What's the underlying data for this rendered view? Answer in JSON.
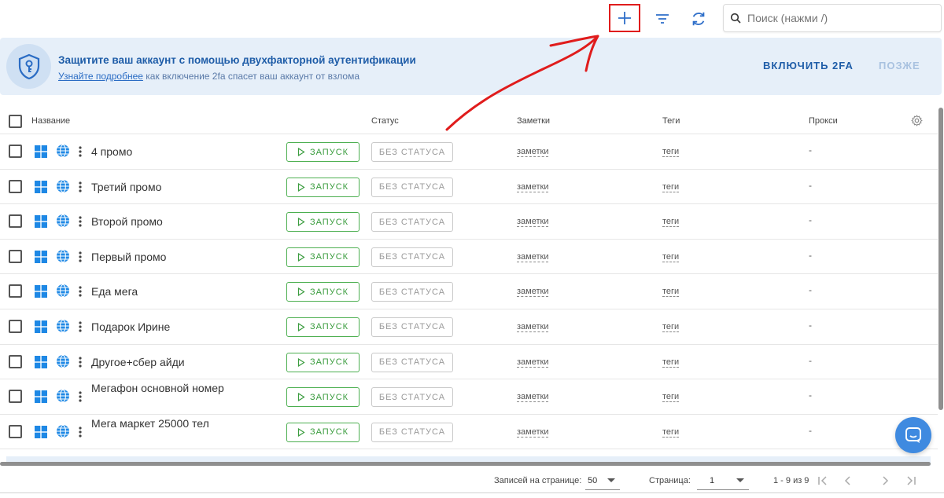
{
  "toolbar": {
    "search_placeholder": "Поиск (нажми /)",
    "icons": [
      "add-icon",
      "filter-icon",
      "refresh-icon",
      "search-icon"
    ]
  },
  "banner": {
    "title": "Защитите ваш аккаунт с помощью двухфакторной аутентификации",
    "learn_more": "Узнайте подробнее",
    "subtitle_rest": " как включение 2fa спасет ваш аккаунт от взлома",
    "enable_label": "ВКЛЮЧИТЬ 2FA",
    "later_label": "ПОЗЖЕ"
  },
  "table": {
    "columns": {
      "name": "Название",
      "status": "Статус",
      "notes": "Заметки",
      "tags": "Теги",
      "proxy": "Прокси"
    },
    "rows": [
      {
        "name": "4 промо",
        "launch": "ЗАПУСК",
        "status": "БЕЗ СТАТУСА",
        "notes": "заметки",
        "tags": "теги",
        "proxy": "-"
      },
      {
        "name": "Третий промо",
        "launch": "ЗАПУСК",
        "status": "БЕЗ СТАТУСА",
        "notes": "заметки",
        "tags": "теги",
        "proxy": "-"
      },
      {
        "name": "Второй промо",
        "launch": "ЗАПУСК",
        "status": "БЕЗ СТАТУСА",
        "notes": "заметки",
        "tags": "теги",
        "proxy": "-"
      },
      {
        "name": "Первый промо",
        "launch": "ЗАПУСК",
        "status": "БЕЗ СТАТУСА",
        "notes": "заметки",
        "tags": "теги",
        "proxy": "-"
      },
      {
        "name": "Еда мега",
        "launch": "ЗАПУСК",
        "status": "БЕЗ СТАТУСА",
        "notes": "заметки",
        "tags": "теги",
        "proxy": "-"
      },
      {
        "name": "Подарок Ирине",
        "launch": "ЗАПУСК",
        "status": "БЕЗ СТАТУСА",
        "notes": "заметки",
        "tags": "теги",
        "proxy": "-"
      },
      {
        "name": "Другое+сбер айди",
        "launch": "ЗАПУСК",
        "status": "БЕЗ СТАТУСА",
        "notes": "заметки",
        "tags": "теги",
        "proxy": "-"
      },
      {
        "name": "Мегафон основной номер",
        "launch": "ЗАПУСК",
        "status": "БЕЗ СТАТУСА",
        "notes": "заметки",
        "tags": "теги",
        "proxy": "-"
      },
      {
        "name": "Мега маркет 25000 тел",
        "launch": "ЗАПУСК",
        "status": "БЕЗ СТАТУСА",
        "notes": "заметки",
        "tags": "теги",
        "proxy": "-"
      }
    ]
  },
  "footer": {
    "per_page_label": "Записей на странице:",
    "per_page_value": "50",
    "page_label": "Страница:",
    "page_value": "1",
    "range": "1 - 9 из 9"
  },
  "colors": {
    "accent": "#1f5da8",
    "banner_bg": "#e6eff9",
    "launch_green": "#4caf50",
    "annotation_red": "#e01c1c",
    "windows_blue": "#1e88e5"
  }
}
